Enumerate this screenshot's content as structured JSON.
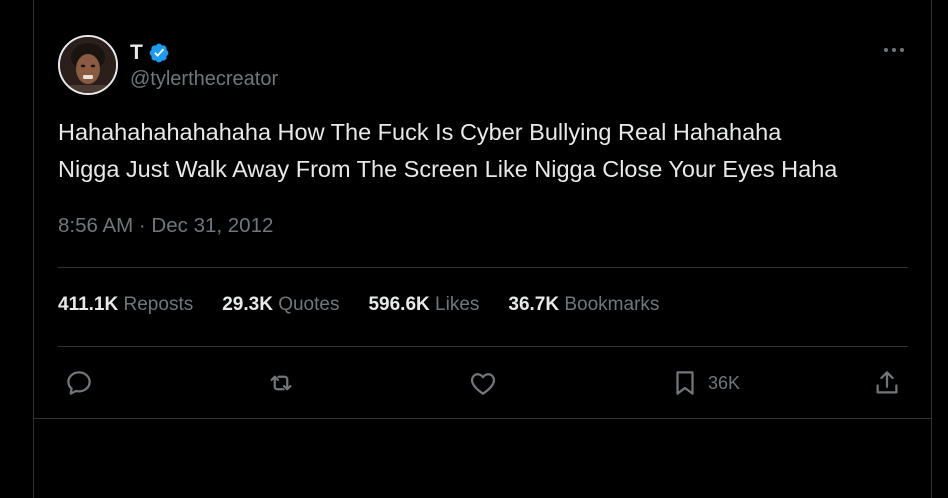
{
  "author": {
    "display_name": "T",
    "handle": "@tylerthecreator"
  },
  "tweet": {
    "text": "Hahahahahahahaha How The Fuck Is Cyber Bullying Real Hahahaha\nNigga Just Walk Away From The Screen Like Nigga Close Your Eyes Haha",
    "timestamp": "8:56 AM · Dec 31, 2012"
  },
  "stats": [
    {
      "value": "411.1K",
      "label": "Reposts"
    },
    {
      "value": "29.3K",
      "label": "Quotes"
    },
    {
      "value": "596.6K",
      "label": "Likes"
    },
    {
      "value": "36.7K",
      "label": "Bookmarks"
    }
  ],
  "actions": {
    "reply_icon": "reply-icon",
    "repost_icon": "repost-icon",
    "like_icon": "like-icon",
    "bookmark_icon": "bookmark-icon",
    "bookmark_count": "36K",
    "share_icon": "share-icon"
  },
  "colors": {
    "background": "#000000",
    "text": "#e7e9ea",
    "muted": "#71767b",
    "border": "#2f3336",
    "verified": "#1d9bf0"
  }
}
